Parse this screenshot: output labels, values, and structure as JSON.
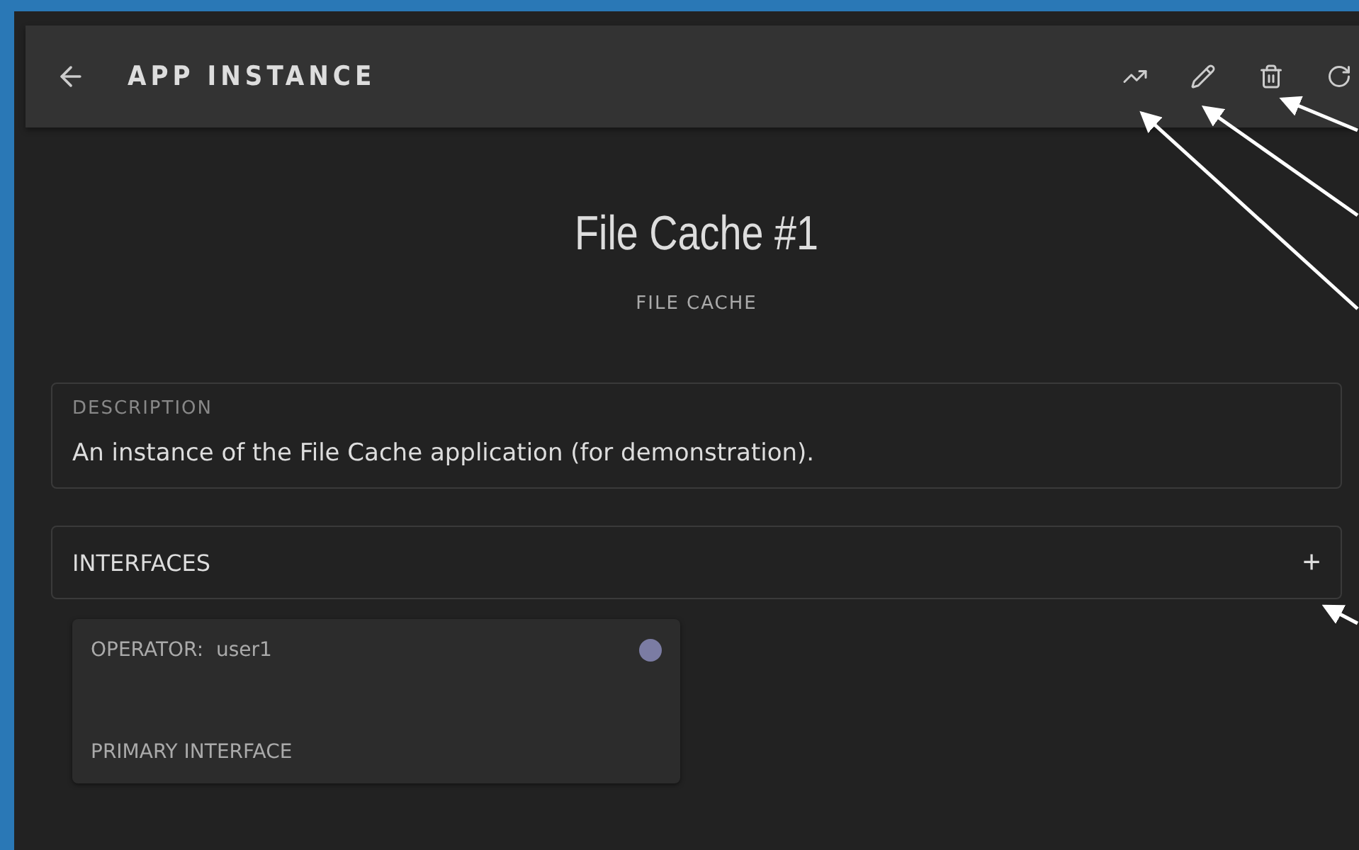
{
  "app_bar": {
    "title": "APP INSTANCE",
    "actions": [
      {
        "kind": "chart"
      },
      {
        "kind": "edit"
      },
      {
        "kind": "delete"
      },
      {
        "kind": "refresh"
      }
    ]
  },
  "heading": {
    "title": "File Cache #1",
    "subtitle": "FILE CACHE"
  },
  "description": {
    "label": "DESCRIPTION",
    "text": "An instance of the File Cache application (for demonstration)."
  },
  "interfaces": {
    "label": "INTERFACES",
    "add": "+",
    "items": [
      {
        "operator_label": "OPERATOR:",
        "operator": "user1",
        "type": "PRIMARY INTERFACE",
        "color": "#7b7ca3"
      }
    ]
  }
}
